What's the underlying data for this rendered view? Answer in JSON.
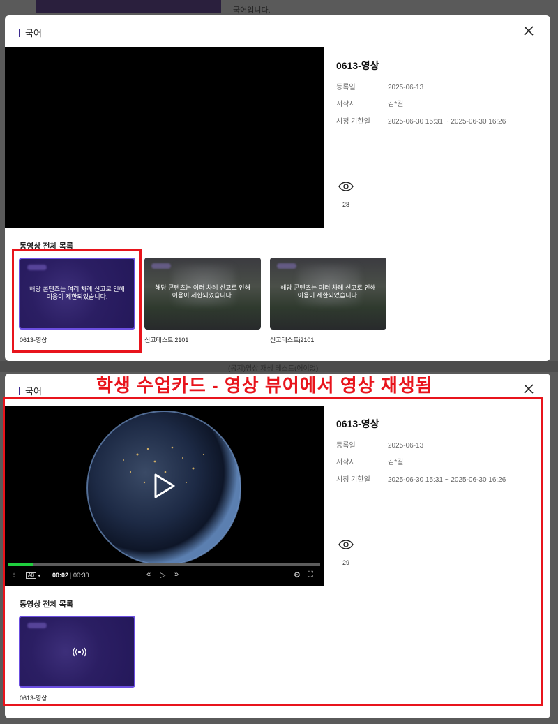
{
  "background": {
    "top_text": "국어입니다.",
    "mid_text": "(공지)영상 재생 테스트(어이없)"
  },
  "annotation": {
    "label": "학생 수업카드 - 영상 뷰어에서 영상 재생됨",
    "color": "#e8141c"
  },
  "modal1": {
    "header_title": "국어",
    "video_title": "0613-영상",
    "registered_label": "등록일",
    "registered_value": "2025-06-13",
    "author_label": "저작자",
    "author_value": "김*길",
    "period_label": "시청 기한일",
    "period_value": "2025-06-30 15:31 ~ 2025-06-30 16:26",
    "view_count": "28",
    "list_title": "동영상 전체 목록",
    "thumbnails": [
      {
        "caption": "0613-영상",
        "message_line1": "해당 콘텐츠는 여러 차례 신고로 인해",
        "message_line2": "이용이 제한되었습니다."
      },
      {
        "caption": "신고테스트j2101",
        "message_line1": "해당 콘텐츠는 여러 차례 신고로 인해",
        "message_line2": "이용이 제한되었습니다."
      },
      {
        "caption": "신고테스트j2101",
        "message_line1": "해당 콘텐츠는 여러 차례 신고로 인해",
        "message_line2": "이용이 제한되었습니다."
      }
    ]
  },
  "modal2": {
    "header_title": "국어",
    "video_title": "0613-영상",
    "registered_label": "등록일",
    "registered_value": "2025-06-13",
    "author_label": "저작자",
    "author_value": "김*길",
    "period_label": "시청 기한일",
    "period_value": "2025-06-30 15:31 ~ 2025-06-30 16:26",
    "view_count": "29",
    "list_title": "동영상 전체 목록",
    "player": {
      "current_time": "00:02",
      "duration": "00:30",
      "progress": 0.08
    },
    "thumbnails": [
      {
        "caption": "0613-영상"
      }
    ]
  },
  "colors": {
    "accent": "#6b4ee0",
    "progress": "#1fcf3e"
  }
}
